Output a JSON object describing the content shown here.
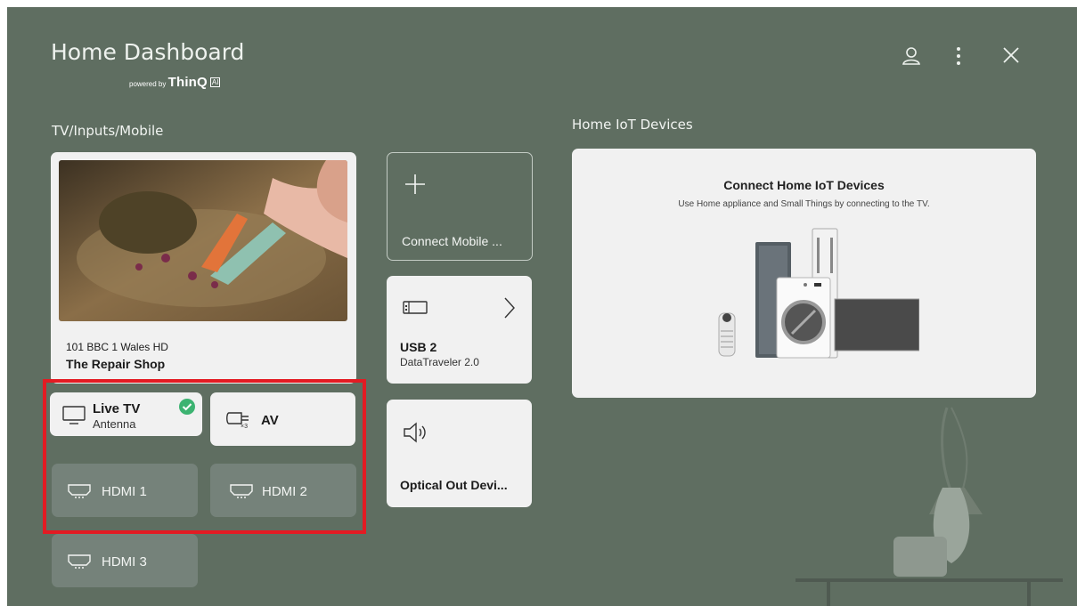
{
  "header": {
    "title": "Home Dashboard",
    "powered_by": "powered by",
    "brand": "ThinQ",
    "brand_badge": "AI",
    "icons": [
      "user-icon",
      "more-vertical-icon",
      "close-icon"
    ]
  },
  "inputs_section": {
    "title": "TV/Inputs/Mobile",
    "now_playing": {
      "channel": "101 BBC 1 Wales HD",
      "program": "The Repair Shop"
    },
    "sources": [
      {
        "label": "Live TV",
        "sub": "Antenna",
        "icon": "tv-icon",
        "selected": true
      },
      {
        "label": "AV",
        "icon": "av-cable-icon",
        "icon_text": "×3"
      },
      {
        "label": "HDMI 1",
        "icon": "hdmi-icon"
      },
      {
        "label": "HDMI 2",
        "icon": "hdmi-icon"
      },
      {
        "label": "HDMI 3",
        "icon": "hdmi-icon"
      }
    ],
    "connect_mobile": {
      "label": "Connect Mobile ...",
      "icon": "plus-icon"
    },
    "usb": {
      "title": "USB 2",
      "sub": "DataTraveler 2.0",
      "icon": "usb-drive-icon",
      "arrow": "chevron-right-icon"
    },
    "optical": {
      "label": "Optical Out Devi...",
      "icon": "speaker-icon"
    }
  },
  "iot_section": {
    "title": "Home IoT Devices",
    "card_title": "Connect Home IoT Devices",
    "card_sub": "Use Home appliance and Small Things by connecting to the TV."
  },
  "colors": {
    "background": "#5f6e61",
    "card": "#f1f1f1",
    "dim_card": "#75827a",
    "selected_check": "#3cb371",
    "highlight": "#e31b23"
  }
}
